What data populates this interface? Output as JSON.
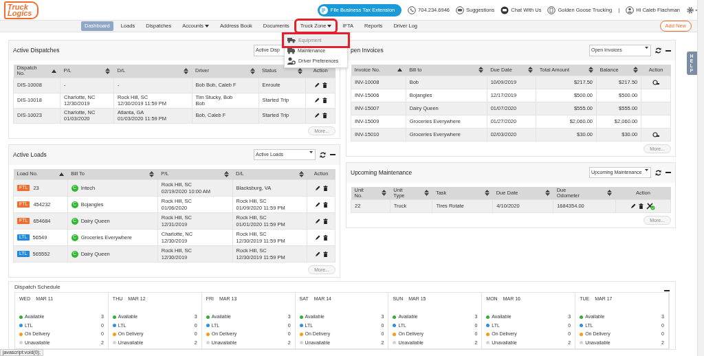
{
  "header": {
    "logo": [
      "Truck",
      "Logics"
    ],
    "tax_button": "File Business Tax Extension",
    "items": [
      {
        "kind": "phone",
        "text": "704.234.6946"
      },
      {
        "kind": "suggest",
        "text": "Suggestions"
      },
      {
        "kind": "chat",
        "text": "Chat With Us"
      },
      {
        "kind": "company",
        "text": "Golden Goose Trucking"
      }
    ],
    "separator": "|",
    "user": "Hi Caleb Flachman"
  },
  "nav": {
    "items": [
      {
        "label": "Dashboard",
        "selected": true,
        "dropdown": false,
        "highlighted": false
      },
      {
        "label": "Loads",
        "selected": false,
        "dropdown": false,
        "highlighted": false
      },
      {
        "label": "Dispatches",
        "selected": false,
        "dropdown": false,
        "highlighted": false
      },
      {
        "label": "Accounts",
        "selected": false,
        "dropdown": true,
        "highlighted": false
      },
      {
        "label": "Address Book",
        "selected": false,
        "dropdown": false,
        "highlighted": false
      },
      {
        "label": "Documents",
        "selected": false,
        "dropdown": false,
        "highlighted": false
      },
      {
        "label": "Truck Zone",
        "selected": false,
        "dropdown": true,
        "highlighted": true
      },
      {
        "label": "IFTA",
        "selected": false,
        "dropdown": false,
        "highlighted": false
      },
      {
        "label": "Reports",
        "selected": false,
        "dropdown": false,
        "highlighted": false
      },
      {
        "label": "Driver Log",
        "selected": false,
        "dropdown": false,
        "highlighted": false
      }
    ],
    "add_button": "Add New"
  },
  "menu": {
    "items": [
      {
        "kind": "equipment",
        "label": "Equipment",
        "selected": true,
        "highlighted": true
      },
      {
        "kind": "maintenance",
        "label": "Maintenance",
        "selected": false,
        "highlighted": false
      },
      {
        "kind": "driver",
        "label": "Driver Preferences",
        "selected": false,
        "highlighted": false
      }
    ]
  },
  "help_tab": "HELP",
  "left_panels": [
    {
      "title": "Active Dispatches",
      "filter": "Active Disp",
      "more": "More...",
      "columns": [
        {
          "kind": "text",
          "label": "Dispatch\nNo.",
          "sortable": true,
          "sorted": true
        },
        {
          "kind": "text",
          "label": "P/L",
          "sortable": true,
          "sorted": false
        },
        {
          "kind": "text",
          "label": "D/L",
          "sortable": true,
          "sorted": false
        },
        {
          "kind": "text",
          "label": "Driver",
          "sortable": true,
          "sorted": false
        },
        {
          "kind": "text",
          "label": "Status",
          "sortable": true,
          "sorted": false
        },
        {
          "kind": "action",
          "label": "Action"
        }
      ],
      "rows": [
        {
          "cells": [
            "DIS-10008",
            "-",
            "-",
            "Bob Bob, Caleb F",
            "Enroute"
          ],
          "actions": [
            {
              "kind": "edit"
            },
            {
              "kind": "delete"
            }
          ]
        },
        {
          "cells": [
            "DIS-10018",
            "Charlotte, NC\n12/30/2019",
            "Rock Hill, SC\n12/30/2019 11:59 PM",
            "Tim Stucky, Bob\nBob",
            "Started Trip"
          ],
          "actions": [
            {
              "kind": "edit"
            },
            {
              "kind": "delete"
            }
          ]
        },
        {
          "cells": [
            "DIS-10023",
            "Charlotte, NC\n01/03/2020",
            "Atlanta, GA\n01/03/2020 11:59 PM",
            "Bob, Caleb F",
            "Started Trip"
          ],
          "actions": [
            {
              "kind": "edit"
            },
            {
              "kind": "delete"
            }
          ]
        }
      ]
    },
    {
      "title": "Active Loads",
      "filter": "Active Loads",
      "controls": true,
      "more": "More...",
      "columns": [
        {
          "kind": "text",
          "label": "Load No.",
          "sortable": true,
          "sorted": true
        },
        {
          "kind": "text",
          "label": "Bill To",
          "sortable": true,
          "sorted": false
        },
        {
          "kind": "text",
          "label": "P/L",
          "sortable": true,
          "sorted": false
        },
        {
          "kind": "text",
          "label": "D/L",
          "sortable": true,
          "sorted": false
        },
        {
          "kind": "action",
          "label": "Action"
        }
      ],
      "rows": [
        {
          "cells": [
            {
              "tag": "FTL",
              "color": "#f26d2b",
              "text": "23"
            },
            {
              "badge": "C",
              "text": "Intech"
            },
            "Rock Hill, SC\n02/19/2020 10:00 AM",
            "Blacksburg, VA"
          ],
          "actions": [
            {
              "kind": "edit"
            },
            {
              "kind": "delete"
            }
          ]
        },
        {
          "cells": [
            {
              "tag": "FTL",
              "color": "#f26d2b",
              "text": "454232"
            },
            {
              "badge": "C",
              "text": "Bojangles"
            },
            "Rock Hill, SC\n01/06/2020",
            "Rock Hill, SC\n01/09/2020 11:59 PM"
          ],
          "actions": [
            {
              "kind": "edit"
            },
            {
              "kind": "delete"
            }
          ]
        },
        {
          "cells": [
            {
              "tag": "FTL",
              "color": "#f26d2b",
              "text": "654684"
            },
            {
              "badge": "C",
              "text": "Dairy Queen"
            },
            "Rock Hill, SC\n12/31/2019",
            "Rock Hill, SC\n01/01/2020 11:59 PM"
          ],
          "actions": [
            {
              "kind": "edit"
            },
            {
              "kind": "delete"
            }
          ]
        },
        {
          "cells": [
            {
              "tag": "LTL",
              "color": "#1e88e5",
              "text": "56549"
            },
            {
              "badge": "C",
              "text": "Groceries Everywhere"
            },
            "Charlotte, NC\n12/30/2019",
            "Rock Hill, SC\n12/30/2019 11:59 PM"
          ],
          "actions": [
            {
              "kind": "edit"
            },
            {
              "kind": "delete"
            }
          ]
        },
        {
          "cells": [
            {
              "tag": "LTL",
              "color": "#1e88e5",
              "text": "565552"
            },
            {
              "badge": "C",
              "text": "Dairy Queen"
            },
            "Rock Hill, SC\n12/30/2019",
            "Rock Hill, SC\n12/30/2019 11:59 PM"
          ],
          "actions": [
            {
              "kind": "edit"
            },
            {
              "kind": "delete"
            }
          ]
        }
      ]
    }
  ],
  "right_panels": [
    {
      "title": "pen Invoices",
      "filter": "Open Invoices",
      "controls": true,
      "more": "More...",
      "columns": [
        {
          "kind": "text",
          "label": "Invoice No.",
          "sortable": true,
          "sorted": true
        },
        {
          "kind": "text",
          "label": "Bill to",
          "sortable": true,
          "sorted": false
        },
        {
          "kind": "text",
          "label": "Due Date",
          "sortable": true,
          "sorted": false
        },
        {
          "kind": "money",
          "label": "Total Amount",
          "sortable": true,
          "sorted": false
        },
        {
          "kind": "money",
          "label": "Balance",
          "sortable": true,
          "sorted": false
        },
        {
          "kind": "action",
          "label": "Action"
        }
      ],
      "rows": [
        {
          "cells": [
            "INV-10008",
            "Bob",
            "10/09/2019",
            "$217.50",
            "$217.50"
          ],
          "actions": [
            {
              "kind": "payment"
            }
          ]
        },
        {
          "cells": [
            "INV-15006",
            "Bojangles",
            "12/17/2019",
            "$500.00",
            "$500.00"
          ],
          "actions": []
        },
        {
          "cells": [
            "INV-15007",
            "Dairy Queen",
            "01/07/2020",
            "$555.00",
            "$555.00"
          ],
          "actions": []
        },
        {
          "cells": [
            "INV-15009",
            "Groceries Everywhere",
            "01/27/2020",
            "$2,060.00",
            "$2,060.00"
          ],
          "actions": []
        },
        {
          "cells": [
            "INV-15010",
            "Groceries Everywhere",
            "02/03/2020",
            "$30.00",
            "$30.00"
          ],
          "actions": [
            {
              "kind": "payment"
            }
          ]
        }
      ]
    },
    {
      "title": "Upcoming Maintenance",
      "filter": "Upcoming Maintenance",
      "controls": true,
      "more": "More...",
      "columns": [
        {
          "kind": "text",
          "label": "Unit\nNo.",
          "sortable": true,
          "sorted": false
        },
        {
          "kind": "text",
          "label": "Unit\nType",
          "sortable": true,
          "sorted": false
        },
        {
          "kind": "text",
          "label": "Task",
          "sortable": true,
          "sorted": false
        },
        {
          "kind": "text",
          "label": "Due Date",
          "sortable": true,
          "sorted": false
        },
        {
          "kind": "text",
          "label": "Due\nOdometer",
          "sortable": true,
          "sorted": false
        },
        {
          "kind": "action",
          "label": "Action"
        }
      ],
      "rows": [
        {
          "cells": [
            "22",
            "Truck",
            "Tires Rotate",
            "4/10/2020",
            "1684354.00"
          ],
          "actions": [
            {
              "kind": "edit"
            },
            {
              "kind": "delete"
            },
            {
              "kind": "complete"
            }
          ]
        }
      ]
    }
  ],
  "schedule": {
    "title": "Dispatch Schedule",
    "days": [
      {
        "day": "WED",
        "date": "MAR 11",
        "stats": [
          {
            "label": "Available",
            "count": "3",
            "color": "#3aaa35"
          },
          {
            "label": "LTL",
            "count": "0",
            "color": "#2d8fe0"
          },
          {
            "label": "On Delivery",
            "count": "0",
            "color": "#f39c12"
          },
          {
            "label": "Unavailable",
            "count": "2",
            "color": "#d5d5d5"
          }
        ]
      },
      {
        "day": "THU",
        "date": "MAR 12",
        "stats": [
          {
            "label": "Available",
            "count": "3",
            "color": "#3aaa35"
          },
          {
            "label": "LTL",
            "count": "0",
            "color": "#2d8fe0"
          },
          {
            "label": "On Delivery",
            "count": "0",
            "color": "#f39c12"
          },
          {
            "label": "Unavailable",
            "count": "2",
            "color": "#d5d5d5"
          }
        ]
      },
      {
        "day": "FRI",
        "date": "MAR 13",
        "stats": [
          {
            "label": "Available",
            "count": "3",
            "color": "#3aaa35"
          },
          {
            "label": "LTL",
            "count": "0",
            "color": "#2d8fe0"
          },
          {
            "label": "On Delivery",
            "count": "0",
            "color": "#f39c12"
          },
          {
            "label": "Unavailable",
            "count": "2",
            "color": "#d5d5d5"
          }
        ]
      },
      {
        "day": "SAT",
        "date": "MAR 14",
        "stats": [
          {
            "label": "Available",
            "count": "3",
            "color": "#3aaa35"
          },
          {
            "label": "LTL",
            "count": "0",
            "color": "#2d8fe0"
          },
          {
            "label": "On Delivery",
            "count": "0",
            "color": "#f39c12"
          },
          {
            "label": "Unavailable",
            "count": "2",
            "color": "#d5d5d5"
          }
        ]
      },
      {
        "day": "SUN",
        "date": "MAR 15",
        "stats": [
          {
            "label": "Available",
            "count": "3",
            "color": "#3aaa35"
          },
          {
            "label": "LTL",
            "count": "0",
            "color": "#2d8fe0"
          },
          {
            "label": "On Delivery",
            "count": "0",
            "color": "#f39c12"
          },
          {
            "label": "Unavailable",
            "count": "2",
            "color": "#d5d5d5"
          }
        ]
      },
      {
        "day": "MON",
        "date": "MAR 16",
        "stats": [
          {
            "label": "Available",
            "count": "3",
            "color": "#3aaa35"
          },
          {
            "label": "LTL",
            "count": "0",
            "color": "#2d8fe0"
          },
          {
            "label": "On Delivery",
            "count": "0",
            "color": "#f39c12"
          },
          {
            "label": "Unavailable",
            "count": "2",
            "color": "#d5d5d5"
          }
        ]
      },
      {
        "day": "TUE",
        "date": "MAR 17",
        "stats": [
          {
            "label": "Available",
            "count": "3",
            "color": "#3aaa35"
          },
          {
            "label": "LTL",
            "count": "0",
            "color": "#2d8fe0"
          },
          {
            "label": "On Delivery",
            "count": "0",
            "color": "#f39c12"
          },
          {
            "label": "Unavailable",
            "count": "2",
            "color": "#d5d5d5"
          }
        ]
      }
    ]
  },
  "status_bar": "javascript:void(0);"
}
